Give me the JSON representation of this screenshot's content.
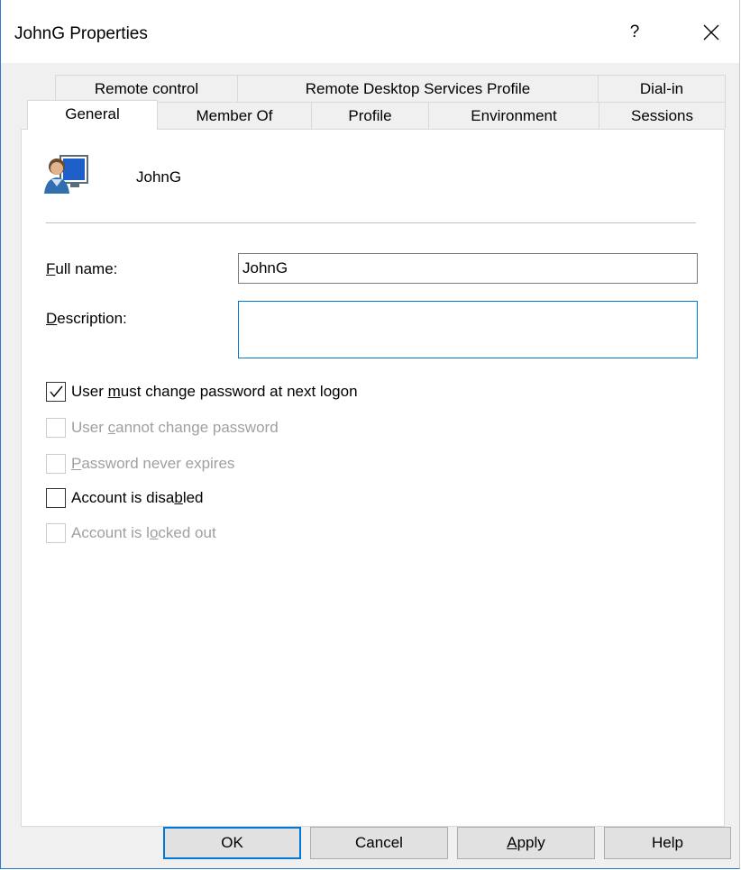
{
  "window": {
    "title": "JohnG Properties",
    "help_label": "?"
  },
  "tabs_back": [
    "Remote control",
    "Remote Desktop Services Profile",
    "Dial-in"
  ],
  "tabs_front": [
    "General",
    "Member Of",
    "Profile",
    "Environment",
    "Sessions"
  ],
  "active_tab": "General",
  "general": {
    "user_display": "JohnG",
    "full_name": {
      "pre": "",
      "key": "F",
      "post": "ull name:",
      "value": "JohnG"
    },
    "description": {
      "pre": "",
      "key": "D",
      "post": "escription:",
      "value": ""
    },
    "checkboxes": [
      {
        "pre": "User ",
        "key": "m",
        "post": "ust change password at next logon",
        "checked": true,
        "enabled": true
      },
      {
        "pre": "User ",
        "key": "c",
        "post": "annot change password",
        "checked": false,
        "enabled": false
      },
      {
        "pre": "",
        "key": "P",
        "post": "assword never expires",
        "checked": false,
        "enabled": false
      },
      {
        "pre": "Account is disa",
        "key": "b",
        "post": "led",
        "checked": false,
        "enabled": true
      },
      {
        "pre": "Account is l",
        "key": "o",
        "post": "cked out",
        "checked": false,
        "enabled": false
      }
    ]
  },
  "buttons": {
    "ok": "OK",
    "cancel": "Cancel",
    "apply": {
      "pre": "",
      "key": "A",
      "post": "pply"
    },
    "help": "Help"
  },
  "colors": {
    "accent": "#0078d7",
    "disabled_text": "#a0a0a0"
  },
  "icons": {
    "close": "close-icon",
    "user": "user-computer-icon",
    "check": "checkmark-icon"
  }
}
